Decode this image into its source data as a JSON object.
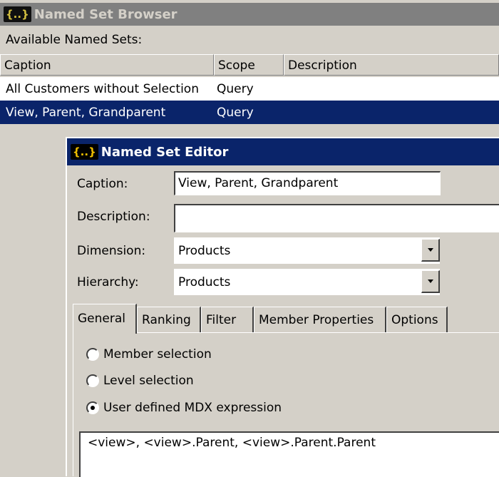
{
  "browser": {
    "title_icon": "{..}",
    "title": "Named Set Browser",
    "available_label": "Available Named Sets:",
    "columns": [
      "Caption",
      "Scope",
      "Description"
    ],
    "rows": [
      {
        "caption": "All Customers without Selection",
        "scope": "Query",
        "description": ""
      },
      {
        "caption": "View, Parent, Grandparent",
        "scope": "Query",
        "description": ""
      }
    ],
    "selected_row": 1
  },
  "editor": {
    "title_icon": "{..}",
    "title": "Named Set Editor",
    "caption_label": "Caption:",
    "caption_value": "View, Parent, Grandparent",
    "description_label": "Description:",
    "description_value": "",
    "dimension_label": "Dimension:",
    "dimension_value": "Products",
    "hierarchy_label": "Hierarchy:",
    "hierarchy_value": "Products",
    "tabs": [
      "General",
      "Ranking",
      "Filter",
      "Member Properties",
      "Options"
    ],
    "active_tab": "General",
    "radios": [
      {
        "label": "Member selection",
        "checked": false
      },
      {
        "label": "Level selection",
        "checked": false
      },
      {
        "label": "User defined MDX expression",
        "checked": true
      }
    ],
    "mdx_expression": "<view>, <view>.Parent, <view>.Parent.Parent"
  },
  "colors": {
    "selection": "#0a246a",
    "window_bg": "#d4d0c8",
    "inactive_title": "#808080"
  }
}
